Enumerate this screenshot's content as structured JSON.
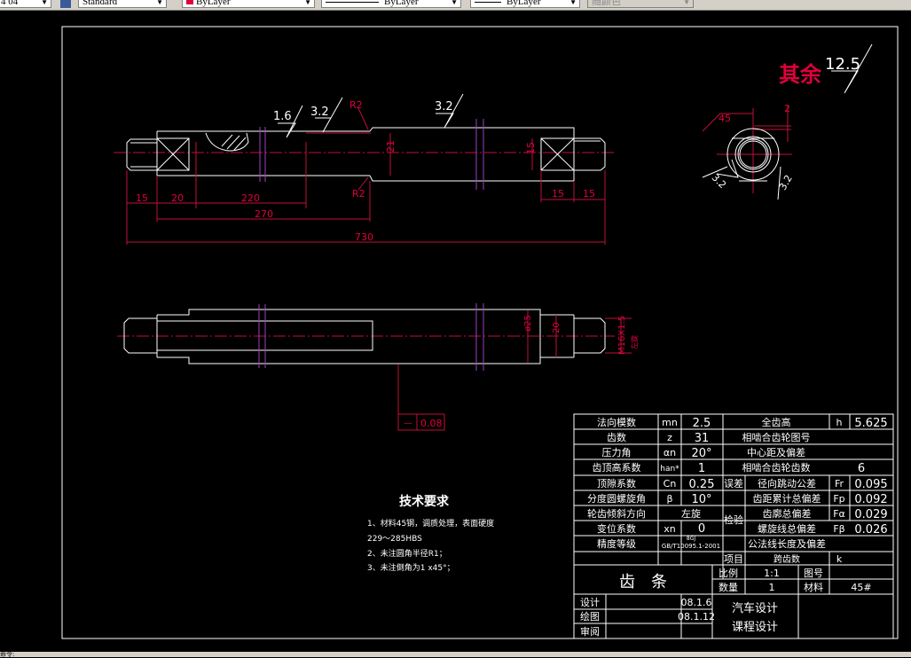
{
  "toolbar": {
    "scale_value": "4 04",
    "text_style": "Standard",
    "color": "ByLayer",
    "linetype": "ByLayer",
    "lineweight": "ByLayer",
    "plot_style": "随颜色",
    "color_swatch": "#e0003c"
  },
  "drawing": {
    "roughness_other_label": "其余",
    "roughness_other_value": "12.5",
    "roughness": [
      "1.6",
      "3.2",
      "3.2"
    ],
    "radius_top": "R2",
    "radius_bottom": "R2",
    "dims": {
      "d15a": "15",
      "d20": "20",
      "d220": "220",
      "d270": "270",
      "d730": "730",
      "d21": "21",
      "d15v": "15",
      "d15b": "15",
      "d15c": "15",
      "phi25": "ø25",
      "d20v": "20",
      "thread": "M16X1.5",
      "thread_note": "左旋",
      "chamfer": "45",
      "chamfer_depth": "2",
      "section_r1": "3.2",
      "section_r2": "3.2"
    },
    "tolerance": {
      "symbol": "—",
      "value": "0.08"
    },
    "tech": {
      "title": "技术要求",
      "lines": [
        "1、材料45钢，调质处理，表面硬度",
        "229～285HBS",
        "2、未注圆角半径R1；",
        "3、未注倒角为1 x45°；"
      ]
    }
  },
  "params": [
    {
      "name": "法向模数",
      "sym": "mn",
      "val": "2.5"
    },
    {
      "name": "齿数",
      "sym": "z",
      "val": "31"
    },
    {
      "name": "压力角",
      "sym": "αn",
      "val": "20°"
    },
    {
      "name": "齿顶高系数",
      "sym": "han*",
      "val": "1"
    },
    {
      "name": "顶隙系数",
      "sym": "Cn",
      "val": "0.25"
    },
    {
      "name": "分度圆螺旋角",
      "sym": "β",
      "val": "10°"
    },
    {
      "name": "轮齿倾斜方向",
      "val": "左旋"
    },
    {
      "name": "变位系数",
      "sym": "xn",
      "val": "0"
    },
    {
      "name": "精度等级",
      "val": "GB/T10095.1-2001",
      "val2": "8GJ"
    }
  ],
  "right": {
    "r0": {
      "name": "全齿高",
      "sym": "h",
      "val": "5.625"
    },
    "r1": {
      "name": "相啮合齿轮图号"
    },
    "r2": {
      "name": "中心距及偏差"
    },
    "r3": {
      "name": "相啮合齿轮齿数",
      "val": "6"
    },
    "group1": "误差",
    "group2": "检验",
    "group3": "项目",
    "r4": {
      "name": "径向跳动公差",
      "sym": "Fr",
      "val": "0.095"
    },
    "r5": {
      "name": "齿距累计总偏差",
      "sym": "Fp",
      "val": "0.092"
    },
    "r6": {
      "name": "齿廓总偏差",
      "sym": "Fα",
      "val": "0.029"
    },
    "r7": {
      "name": "螺旋线总偏差",
      "sym": "Fβ",
      "val": "0.026"
    },
    "r8": {
      "name": "公法线长度及偏差"
    },
    "r9": {
      "name": "跨齿数",
      "sym": "k"
    }
  },
  "title_block": {
    "part": "齿　条",
    "scale_label": "比例",
    "scale": "1:1",
    "drawing_no_label": "图号",
    "qty_label": "数量",
    "qty": "1",
    "material_label": "材料",
    "material": "45#",
    "design_label": "设计",
    "design_date": "08.1.6",
    "draw_label": "绘图",
    "draw_date": "08.1.12",
    "review_label": "审阅",
    "course1": "汽车设计",
    "course2": "课程设计"
  },
  "status": {
    "text": "命令:"
  }
}
